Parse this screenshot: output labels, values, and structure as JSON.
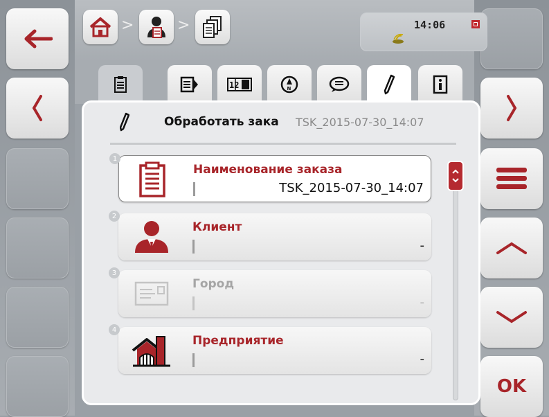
{
  "breadcrumb": {
    "separator": ">",
    "items": [
      "home-icon",
      "customer-icon",
      "documents-icon"
    ]
  },
  "status": {
    "time": "14:06",
    "icons": [
      "task-active-icon",
      "gps-icon"
    ]
  },
  "tabs": [
    {
      "icon": "clipboard-icon",
      "active": false
    },
    {
      "icon": "list-arrow-icon",
      "active": false
    },
    {
      "icon": "counter-icon",
      "active": false
    },
    {
      "icon": "compass-icon",
      "active": false
    },
    {
      "icon": "comment-icon",
      "active": false
    },
    {
      "icon": "pencil-icon",
      "active": true
    },
    {
      "icon": "info-icon",
      "active": false
    }
  ],
  "panel": {
    "title": "Обработать зака",
    "title_code": "TSK_2015-07-30_14:07"
  },
  "fields": [
    {
      "number": "1",
      "label": "Наименование заказа",
      "value": "TSK_2015-07-30_14:07",
      "icon": "clipboard-icon",
      "selected": true,
      "enabled": true
    },
    {
      "number": "2",
      "label": "Клиент",
      "value": "-",
      "icon": "customer-icon",
      "selected": false,
      "enabled": true
    },
    {
      "number": "3",
      "label": "Город",
      "value": "-",
      "icon": "address-card-icon",
      "selected": false,
      "enabled": false
    },
    {
      "number": "4",
      "label": "Предприятие",
      "value": "-",
      "icon": "farm-icon",
      "selected": false,
      "enabled": true
    }
  ],
  "softkeys": {
    "ok_label": "OK"
  },
  "colors": {
    "accent": "#a8252a",
    "background": "#9aa0a6"
  }
}
